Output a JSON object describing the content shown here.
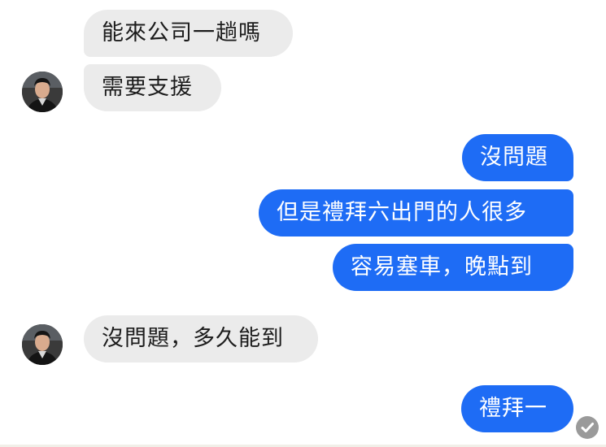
{
  "conversation": {
    "messages": [
      {
        "sender": "contact",
        "text": "能來公司一趟嗎"
      },
      {
        "sender": "contact",
        "text": "需要支援"
      },
      {
        "sender": "me",
        "text": "沒問題"
      },
      {
        "sender": "me",
        "text": "但是禮拜六出門的人很多"
      },
      {
        "sender": "me",
        "text": "容易塞車，晚點到"
      },
      {
        "sender": "contact",
        "text": "沒問題，多久能到"
      },
      {
        "sender": "me",
        "text": "禮拜一"
      }
    ],
    "status": {
      "icon": "check-circle-icon",
      "state": "seen"
    }
  },
  "colors": {
    "outgoing_bubble": "#1e6cf5",
    "incoming_bubble": "#ebebeb",
    "incoming_text": "#1c1c1c",
    "outgoing_text": "#ffffff",
    "seen_indicator": "#9a9a9a"
  }
}
